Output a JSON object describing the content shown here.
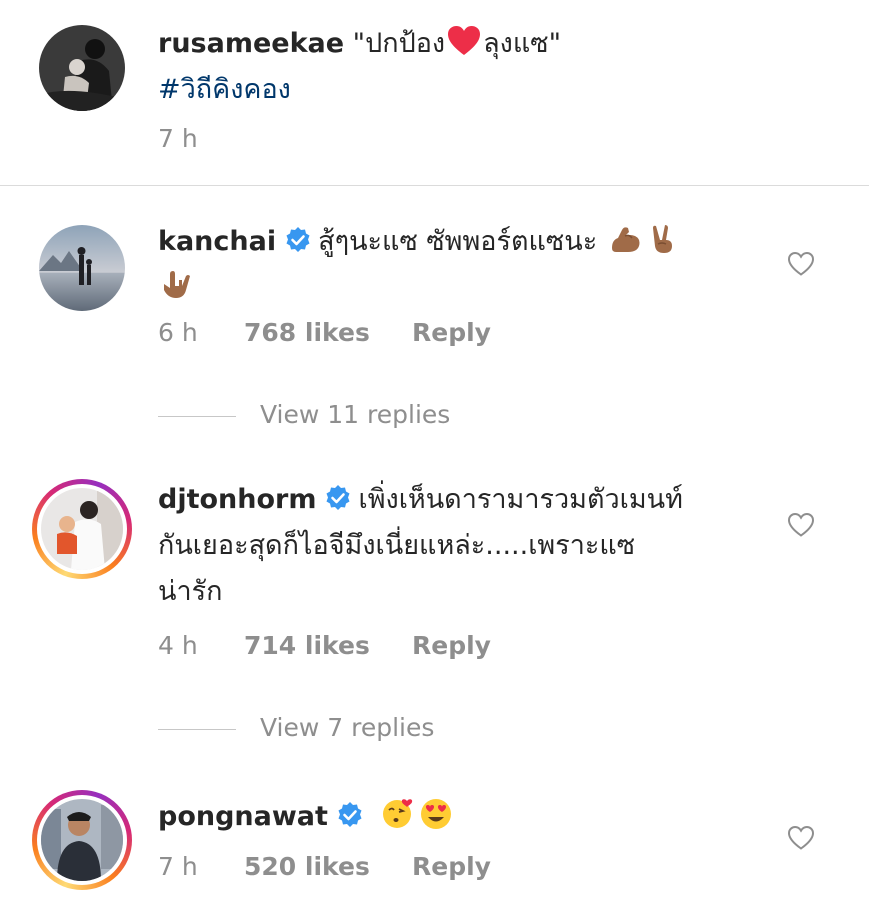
{
  "caption": {
    "username": "rusameekae",
    "text_before_emoji": "\"ปกป้อง",
    "text_after_emoji": "ลุงแซ\"",
    "hashtag": "#วิถีคิงคอง",
    "time": "7 h"
  },
  "comments": [
    {
      "username": "kanchai",
      "verified": true,
      "text": "สู้ๆนะแซ ซัพพอร์ตแซนะ",
      "emoji": [
        "flexed-biceps",
        "victory-hand",
        "love-you-gesture"
      ],
      "time": "6 h",
      "likes": "768 likes",
      "reply_label": "Reply",
      "view_replies": "View 11 replies"
    },
    {
      "username": "djtonhorm",
      "verified": true,
      "text_line1": "เพิ่งเห็นดารามารวมตัวเมนท์",
      "text_line2": "กันเยอะสุดก็ไอจีมึงเนี่ยแหล่ะ.....เพราะแซ",
      "text_line3": "น่ารัก",
      "time": "4 h",
      "likes": "714 likes",
      "reply_label": "Reply",
      "view_replies": "View 7 replies"
    },
    {
      "username": "pongnawat",
      "verified": true,
      "emoji": [
        "kissing-heart-face",
        "heart-eyes-face"
      ],
      "time": "7 h",
      "likes": "520 likes",
      "reply_label": "Reply"
    }
  ],
  "colors": {
    "text": "#262626",
    "secondary": "#8e8e8e",
    "hashtag": "#00376b",
    "verified": "#3897f0",
    "heart_red": "#ed2e48"
  }
}
